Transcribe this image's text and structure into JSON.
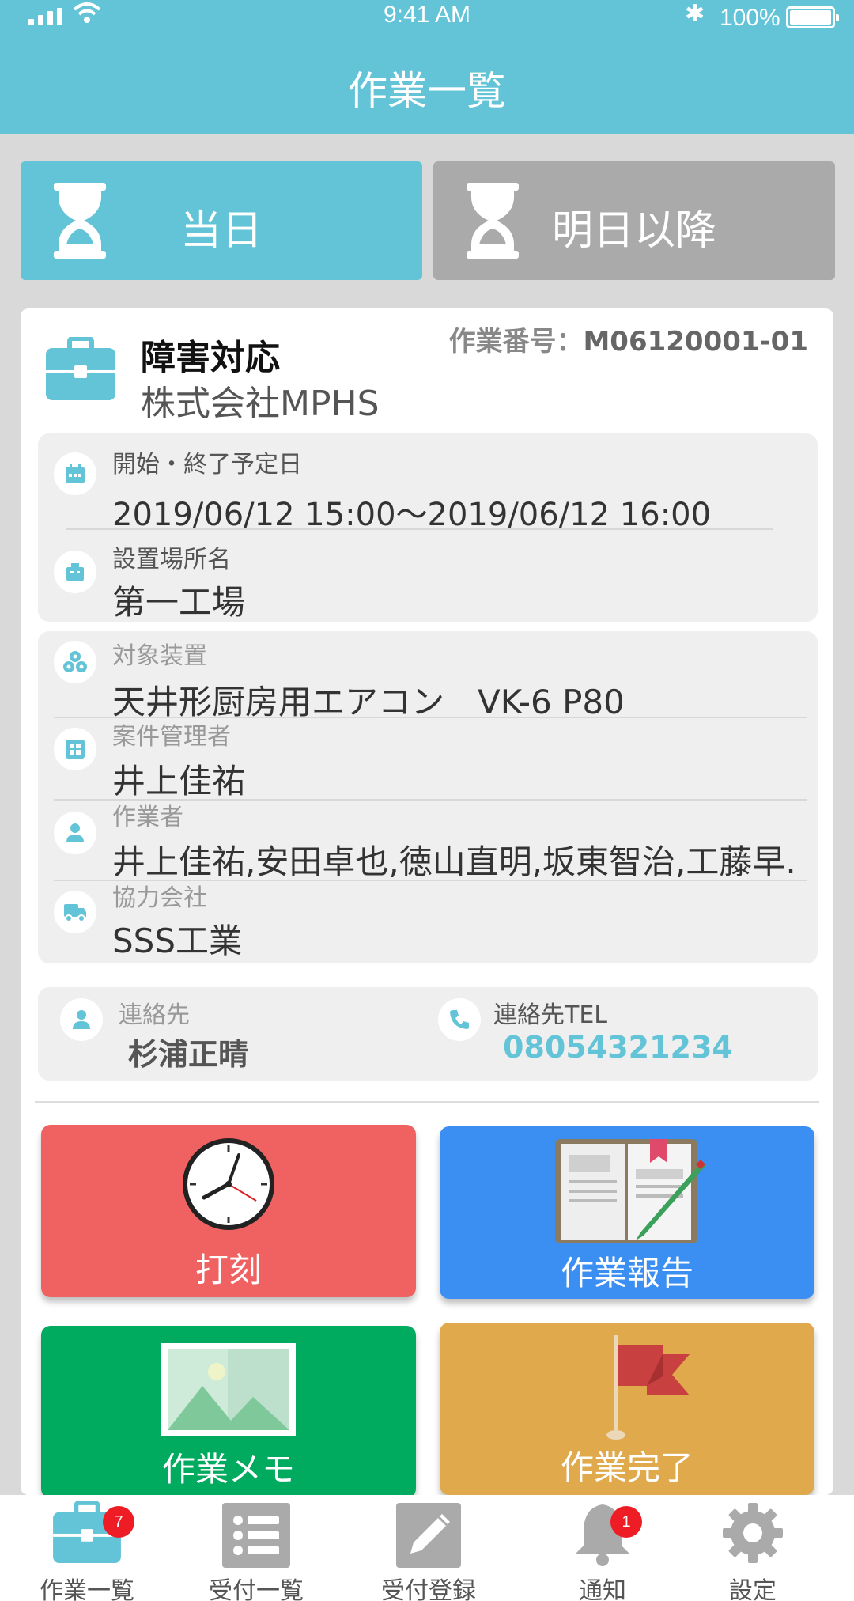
{
  "status": {
    "time": "9:41 AM",
    "battery": "100%"
  },
  "header": {
    "title": "作業一覧"
  },
  "tabs": {
    "today": "当日",
    "later": "明日以降"
  },
  "job": {
    "title": "障害対応",
    "company": "株式会社MPHS",
    "number_label": "作業番号：",
    "number": "M06120001-01",
    "schedule_label": "開始・終了予定日",
    "schedule": "2019/06/12 15:00〜2019/06/12 16:00",
    "location_label": "設置場所名",
    "location": "第一工場",
    "device_label": "対象装置",
    "device": "天井形厨房用エアコン　VK-6 P80",
    "manager_label": "案件管理者",
    "manager": "井上佳祐",
    "workers_label": "作業者",
    "workers": "井上佳祐,安田卓也,徳山直明,坂東智治,工藤早.",
    "partner_label": "協力会社",
    "partner": "SSS工業",
    "contact_label": "連絡先",
    "contact": "杉浦正晴",
    "tel_label": "連絡先TEL",
    "tel": "08054321234"
  },
  "actions": {
    "clock": "打刻",
    "report": "作業報告",
    "memo": "作業メモ",
    "complete": "作業完了"
  },
  "tabbar": {
    "items": [
      {
        "label": "作業一覧",
        "badge": "7"
      },
      {
        "label": "受付一覧"
      },
      {
        "label": "受付登録"
      },
      {
        "label": "通知",
        "badge": "1"
      },
      {
        "label": "設定"
      }
    ]
  },
  "colors": {
    "accent": "#62c4d6",
    "red": "#f06262",
    "blue": "#3b8ef2",
    "green": "#00aa5e",
    "orange": "#e0a94c"
  }
}
